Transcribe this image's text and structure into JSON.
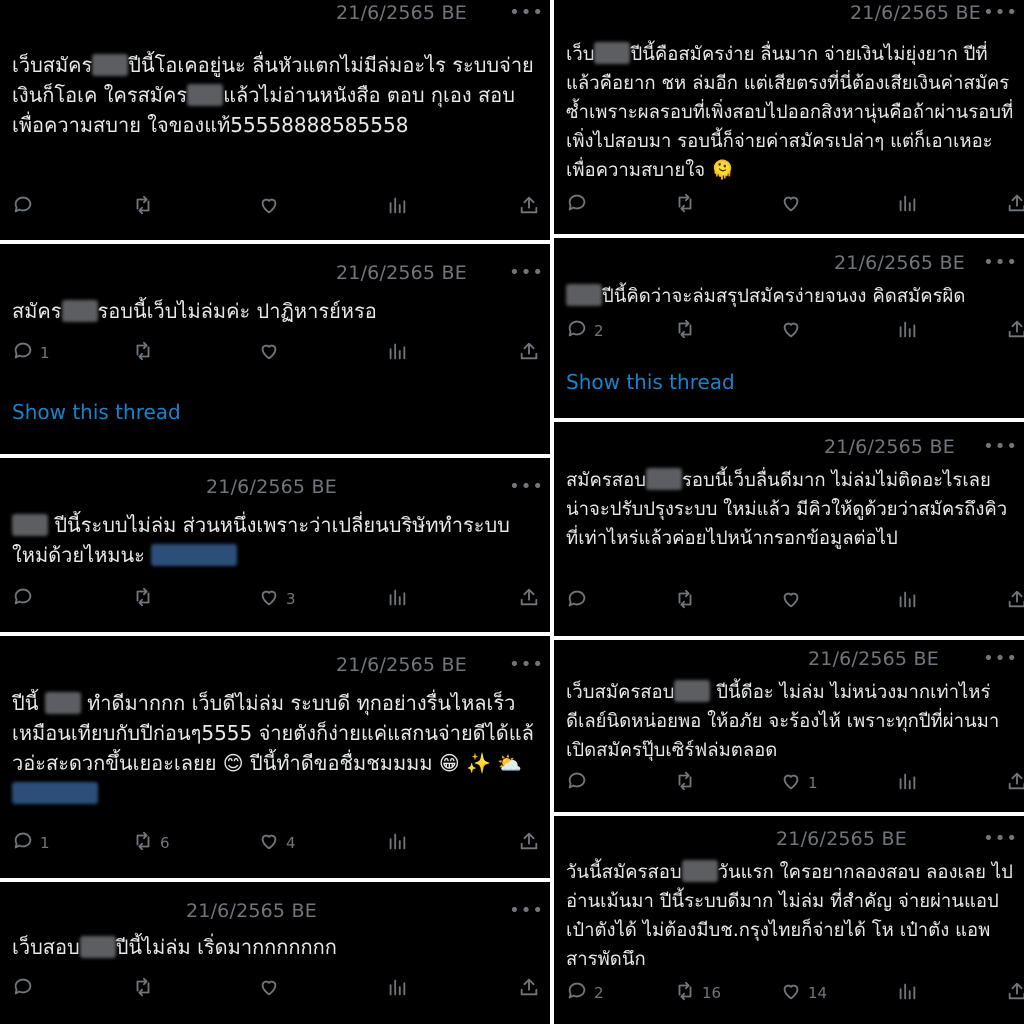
{
  "left": [
    {
      "date": "21/6/2565 BE",
      "text_parts": [
        "เว็บสมัคร",
        "[blur]",
        "ปีนี้โอเคอยู่นะ ลื่นหัวแตกไม่มีล่มอะไร ระบบจ่ายเงินก็โอเค ใครสมัคร",
        "[blur]",
        "แล้วไม่อ่านหนังสือ ตอบ กุเอง สอบเพื่อความสบาย ใจของแท้55558888585558"
      ],
      "reply": "",
      "retweet": "",
      "like": ""
    },
    {
      "date": "21/6/2565 BE",
      "text_parts": [
        "สมัคร",
        "[blur]",
        "รอบนี้เว็บไม่ล่มค่ะ ปาฏิหารย์หรอ"
      ],
      "reply": "1",
      "retweet": "",
      "like": "",
      "show_thread": "Show this thread"
    },
    {
      "date": "21/6/2565 BE",
      "text_parts": [
        "[blur]",
        " ปีนี้ระบบไม่ล่ม ส่วนหนึ่งเพราะว่าเปลี่ยนบริษัททำระบบใหม่ด้วยไหมนะ ",
        "[link]"
      ],
      "reply": "",
      "retweet": "",
      "like": "3"
    },
    {
      "date": "21/6/2565 BE",
      "text_parts": [
        "ปีนี้ ",
        "[blur]",
        " ทำดีมากกก เว็บดีไม่ล่ม ระบบดี ทุกอย่างรื่นไหลเร็วเหมือนเทียบกับปีก่อนๆ5555 จ่ายตังก็ง่ายแค่แสกนจ่ายดีได้แล้วอ่ะสะดวกขึ้นเยอะเลยย 😊 ปีนี้ทำดีขอชื่มชมมมม 😁 ✨ ⛅ ",
        "[link]"
      ],
      "reply": "1",
      "retweet": "6",
      "like": "4"
    },
    {
      "date": "21/6/2565 BE",
      "text_parts": [
        "เว็บสอบ",
        "[blur]",
        "ปีนี้ไม่ล่ม เริ่ดมากกกกกกก"
      ],
      "reply": "",
      "retweet": "",
      "like": ""
    }
  ],
  "right": [
    {
      "date": "21/6/2565 BE",
      "text_parts": [
        "เว็บ",
        "[blur]",
        "ปีนี้คือสมัครง่าย ลื่นมาก จ่ายเงินไม่ยุ่งยาก ปีที่แล้วคือยาก ชห ล่มอีก แต่เสียตรงที่นี่ต้องเสียเงินค่าสมัครซ้ำเพราะผลรอบที่เพิ่งสอบไปออกสิงหานุ่นคือถ้าผ่านรอบที่เพิ่งไปสอบมา รอบนี้ก็จ่ายค่าสมัครเปล่าๆ แต่ก็เอาเหอะ เพื่อความสบายใจ 🫠"
      ],
      "reply": "",
      "retweet": "",
      "like": ""
    },
    {
      "date": "21/6/2565 BE",
      "text_parts": [
        "[blur]",
        "ปีนี้คิดว่าจะล่มสรุปสมัครง่ายจนงง คิดสมัครผิด"
      ],
      "reply": "2",
      "retweet": "",
      "like": "",
      "show_thread": "Show this thread"
    },
    {
      "date": "21/6/2565 BE",
      "text_parts": [
        "สมัครสอบ",
        "[blur]",
        "รอบนี้เว็บลื่นดีมาก ไม่ล่มไม่ติดอะไรเลย น่าจะปรับปรุงระบบ ใหม่แล้ว มีคิวให้ดูด้วยว่าสมัครถึงคิวที่เท่าไหร่แล้วค่อยไปหน้ากรอกข้อมูลต่อไป"
      ],
      "reply": "",
      "retweet": "",
      "like": ""
    },
    {
      "date": "21/6/2565 BE",
      "text_parts": [
        "เว็บสมัครสอบ",
        "[blur]",
        " ปีนี้ดีอะ ไม่ล่ม ไม่หน่วงมากเท่าไหร่ ดีเลย์นิดหน่อยพอ ให้อภัย จะร้องไห้ เพราะทุกปีที่ผ่านมา เปิดสมัครปุ๊บเซิร์ฟล่มตลอด"
      ],
      "reply": "",
      "retweet": "",
      "like": "1"
    },
    {
      "date": "21/6/2565 BE",
      "text_parts": [
        "วันนี้สมัครสอบ",
        "[blur]",
        "วันแรก ใครอยากลองสอบ ลองเลย ไปอ่านเม้นมา ปีนี้ระบบดีมาก ไม่ล่ม ที่สำคัญ จ่ายผ่านแอปเป๋าตังได้ ไม่ต้องมีบช.กรุงไทยก็จ่ายได้ โห เป๋าตัง แอพสารพัดนึก"
      ],
      "reply": "2",
      "retweet": "16",
      "like": "14"
    }
  ],
  "more_label": "•••",
  "icons": [
    "reply-icon",
    "retweet-icon",
    "like-icon",
    "views-icon",
    "share-icon"
  ]
}
